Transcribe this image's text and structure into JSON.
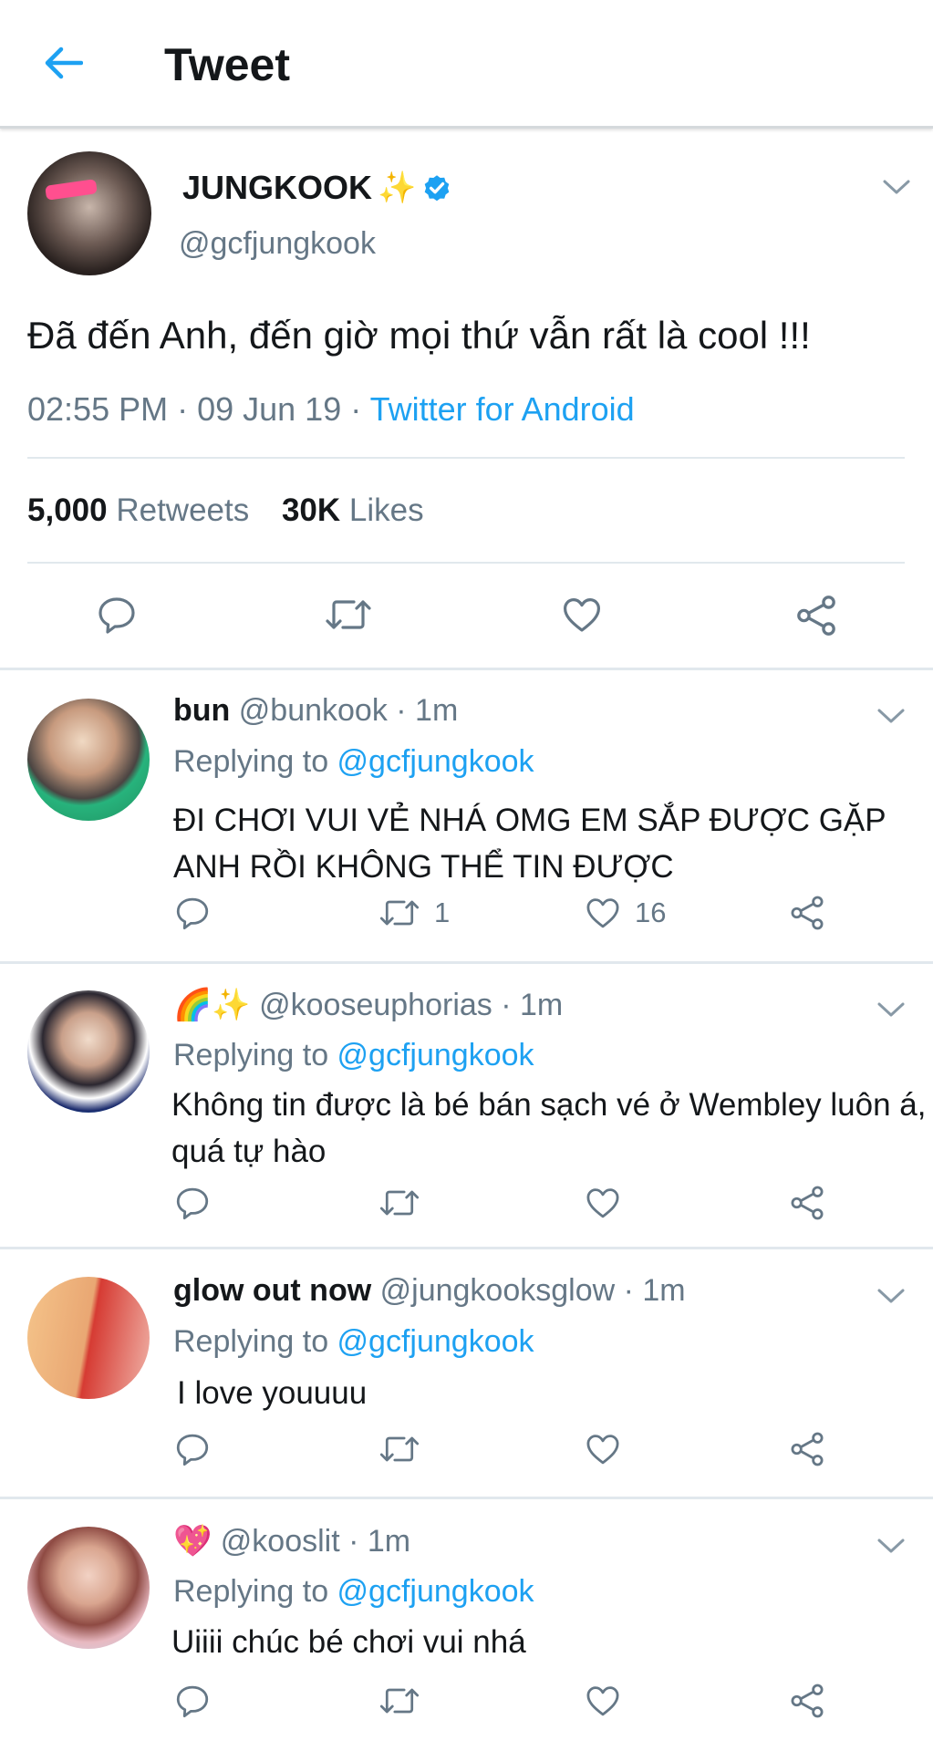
{
  "header": {
    "title": "Tweet"
  },
  "tweet": {
    "name": "JUNGKOOK",
    "name_emoji": "✨",
    "handle": "@gcfjungkook",
    "text": "Đã đến Anh, đến giờ mọi thứ vẫn rất là cool !!!",
    "time": "02:55 PM · 09 Jun 19 · ",
    "source": "Twitter for Android",
    "retweets_count": "5,000",
    "retweets_label": "Retweets",
    "likes_count": "30K",
    "likes_label": "Likes"
  },
  "replies": [
    {
      "name": "bun",
      "handle": "@bunkook",
      "time": " · 1m",
      "replying_prefix": "Replying to ",
      "replying_to": "@gcfjungkook",
      "text": "ĐI CHƠI VUI VẺ NHÁ OMG EM SẮP ĐƯỢC GẶP ANH RỒI KHÔNG THỂ TIN ĐƯỢC",
      "retweets": "1",
      "likes": "16"
    },
    {
      "name_emoji": "🌈✨",
      "handle": "@kooseuphorias",
      "time": " · 1m",
      "replying_prefix": "Replying to ",
      "replying_to": "@gcfjungkook",
      "text": "Không tin được là bé bán sạch vé ở Wembley luôn á, quá tự hào"
    },
    {
      "name": "glow out now",
      "handle": "@jungkooksglow",
      "time": " · 1m",
      "replying_prefix": "Replying to ",
      "replying_to": "@gcfjungkook",
      "text": "I love youuuu"
    },
    {
      "name_emoji": "💖",
      "handle": "@kooslit",
      "time": " · 1m",
      "replying_prefix": "Replying to ",
      "replying_to": "@gcfjungkook",
      "text": "Uiiii chúc bé chơi vui nhá"
    }
  ],
  "icons": [
    "back-arrow-icon",
    "verified-icon",
    "chevron-down-icon",
    "reply-icon",
    "retweet-icon",
    "like-icon",
    "share-icon"
  ],
  "colors": {
    "accent": "#1da1f2",
    "secondary_text": "#657786",
    "primary_text": "#14171a",
    "divider": "#e1e8ed"
  }
}
